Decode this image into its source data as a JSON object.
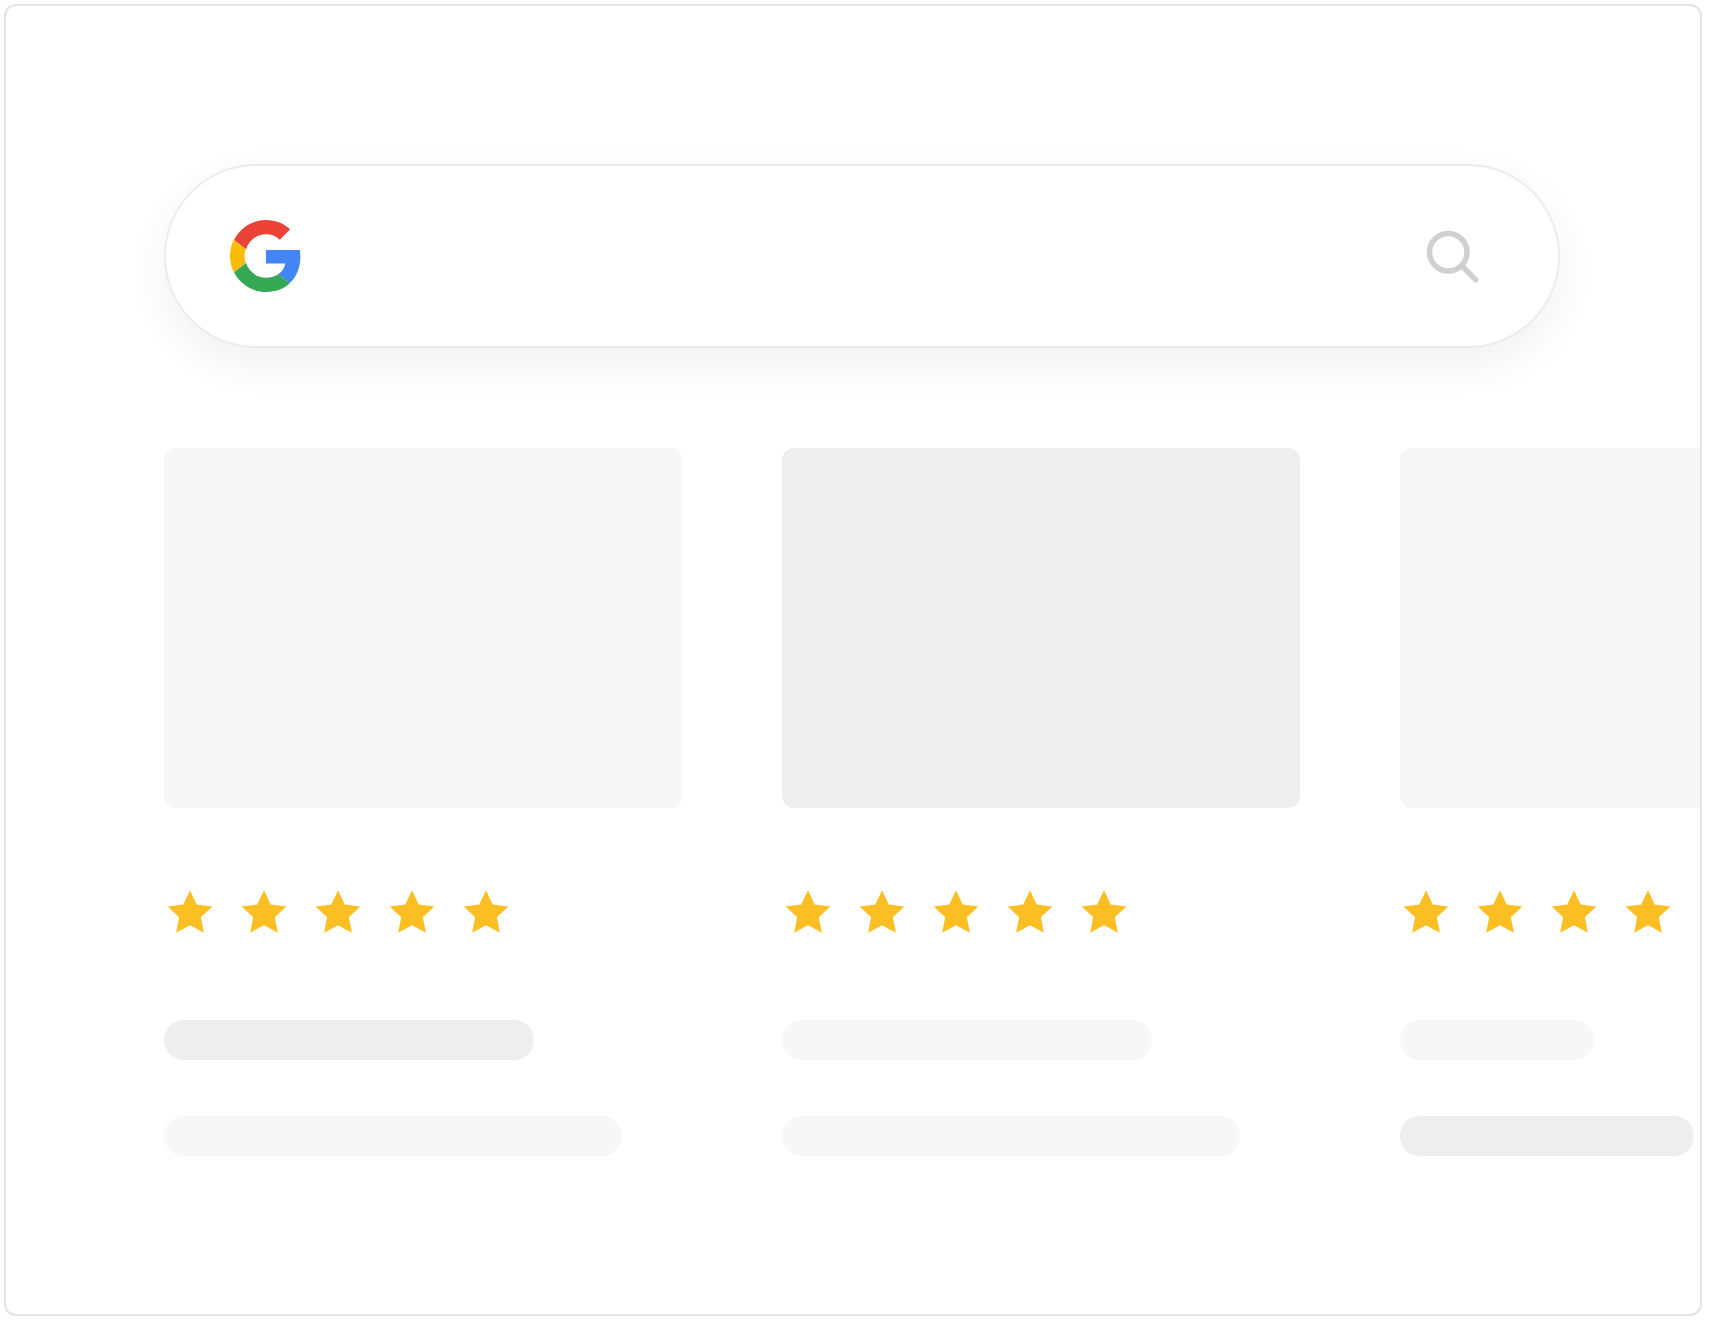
{
  "cards": [
    {
      "image": {
        "color": "#f7f7f7"
      },
      "stars": 5,
      "lines": [
        {
          "color": "#eeeeee"
        },
        {
          "color": "#f7f7f7"
        }
      ]
    },
    {
      "image": {
        "color": "#eeeeee"
      },
      "stars": 5,
      "lines": [
        {
          "color": "#f7f7f7"
        },
        {
          "color": "#f7f7f7"
        }
      ]
    },
    {
      "image": {
        "color": "#f7f7f7"
      },
      "stars": 4,
      "lines": [
        {
          "color": "#f7f7f7"
        },
        {
          "color": "#eeeeee"
        }
      ]
    }
  ]
}
